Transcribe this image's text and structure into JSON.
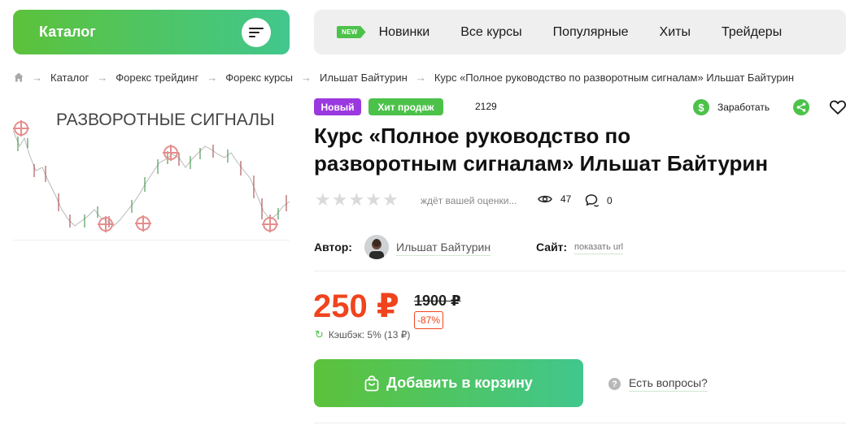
{
  "catalog_button": {
    "label": "Каталог"
  },
  "topnav": {
    "new_tag": "NEW",
    "items": [
      "Новинки",
      "Все курсы",
      "Популярные",
      "Хиты",
      "Трейдеры"
    ]
  },
  "breadcrumb": [
    "Каталог",
    "Форекс трейдинг",
    "Форекс курсы",
    "Ильшат Байтурин",
    "Курс «Полное руководство по разворотным сигналам» Ильшат Байтурин"
  ],
  "image": {
    "caption": "РАЗВОРОТНЫЕ СИГНАЛЫ"
  },
  "badges": {
    "new": "Новый",
    "hit": "Хит продаж"
  },
  "sales_count": "2129",
  "actions": {
    "earn_label": "Заработать"
  },
  "product": {
    "title_line1": "Курс «Полное руководство по",
    "title_line2": "разворотным сигналам» Ильшат Байтурин",
    "rating_text": "ждёт вашей оценки...",
    "views": "47",
    "comments": "0"
  },
  "author": {
    "label": "Автор:",
    "name": "Ильшат Байтурин"
  },
  "site": {
    "label": "Сайт:",
    "link_text": "показать url"
  },
  "pricing": {
    "price": "250 ₽",
    "old_price": "1900 ₽",
    "discount": "-87%",
    "cashback": "Кэшбэк: 5% (13 ₽)"
  },
  "cart": {
    "add_label": "Добавить в корзину"
  },
  "help": {
    "questions_label": "Есть вопросы?"
  },
  "colors": {
    "accent_green": "#4cc24a",
    "price_red": "#f0441e",
    "badge_purple": "#9b39e0"
  }
}
